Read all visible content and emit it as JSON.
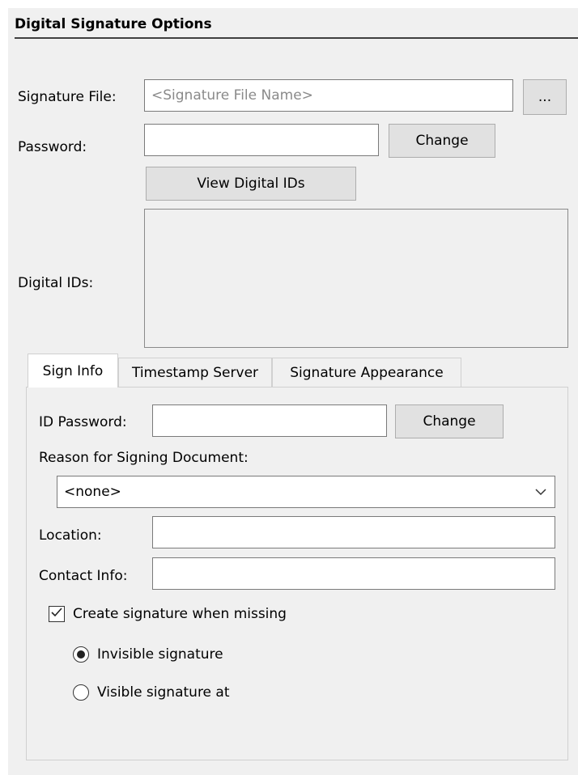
{
  "section": {
    "title": "Digital Signature Options"
  },
  "signature_file": {
    "label": "Signature File:",
    "placeholder": "<Signature File Name>",
    "browse_label": "..."
  },
  "password": {
    "label": "Password:",
    "value": "",
    "change_label": "Change"
  },
  "view_ids": {
    "label": "View Digital IDs"
  },
  "digital_ids": {
    "label": "Digital IDs:",
    "items": []
  },
  "tabs": [
    {
      "label": "Sign Info",
      "active": true
    },
    {
      "label": "Timestamp Server",
      "active": false
    },
    {
      "label": "Signature Appearance",
      "active": false
    }
  ],
  "sign_info": {
    "id_password": {
      "label": "ID Password:",
      "value": "",
      "change_label": "Change"
    },
    "reason": {
      "label": "Reason for Signing Document:",
      "selected": "<none>"
    },
    "location": {
      "label": "Location:",
      "value": ""
    },
    "contact": {
      "label": "Contact Info:",
      "value": ""
    },
    "create_missing": {
      "label": "Create signature when missing",
      "checked": true
    },
    "radio_invisible": {
      "label": "Invisible signature",
      "selected": true
    },
    "radio_visible": {
      "label": "Visible signature at",
      "selected": false
    }
  },
  "icons": {
    "dropdown": "chevron-down-icon",
    "check": "checkmark-icon"
  }
}
